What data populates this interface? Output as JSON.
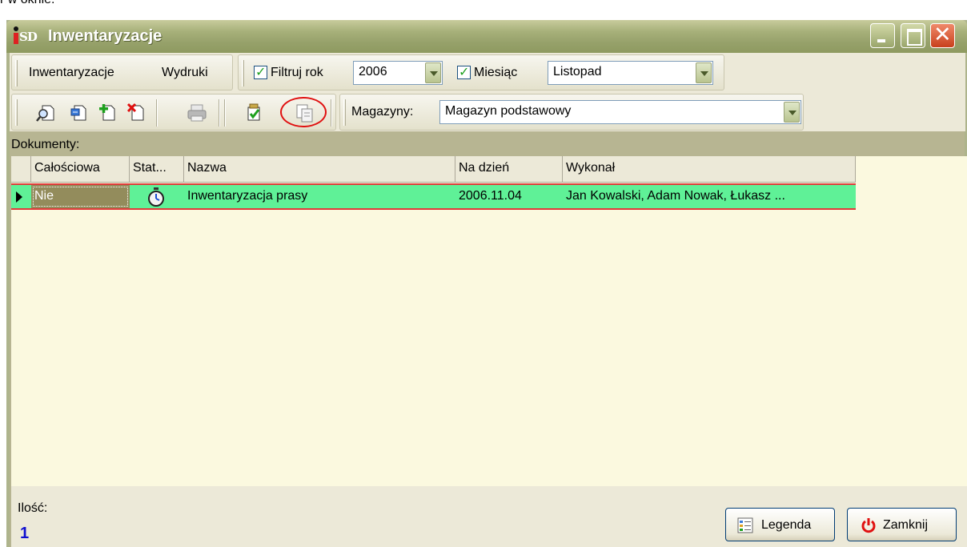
{
  "caption_fragment": "r w oknie.",
  "window": {
    "title": "Inwentaryzacje",
    "app_icon_text": "SD"
  },
  "menu": {
    "item1": "Inwentaryzacje",
    "item2": "Wydruki"
  },
  "filters": {
    "year_checkbox_label": "Filtruj rok",
    "year_value": "2006",
    "month_checkbox_label": "Miesiąc",
    "month_value": "Listopad"
  },
  "magazyny": {
    "label": "Magazyny:",
    "value": "Magazyn podstawowy"
  },
  "section_label": "Dokumenty:",
  "table": {
    "headers": [
      "Całościowa",
      "Stat...",
      "Nazwa",
      "Na dzień",
      "Wykonał"
    ],
    "rows": [
      {
        "calosciowa": "Nie",
        "status_icon": "stopwatch-icon",
        "nazwa": "Inwentaryzacja prasy",
        "na_dzien": "2006.11.04",
        "wykonal": "Jan Kowalski, Adam Nowak, Łukasz ..."
      }
    ]
  },
  "footer": {
    "count_label": "Ilość:",
    "count_value": "1"
  },
  "buttons": {
    "legenda": "Legenda",
    "zamknij": "Zamknij"
  },
  "colors": {
    "selected_row": "#5ff197",
    "grid_background": "#fbf9df",
    "title_bar": "#a7b07a",
    "highlight_ring": "#e01010",
    "count_value": "#1010d0"
  }
}
